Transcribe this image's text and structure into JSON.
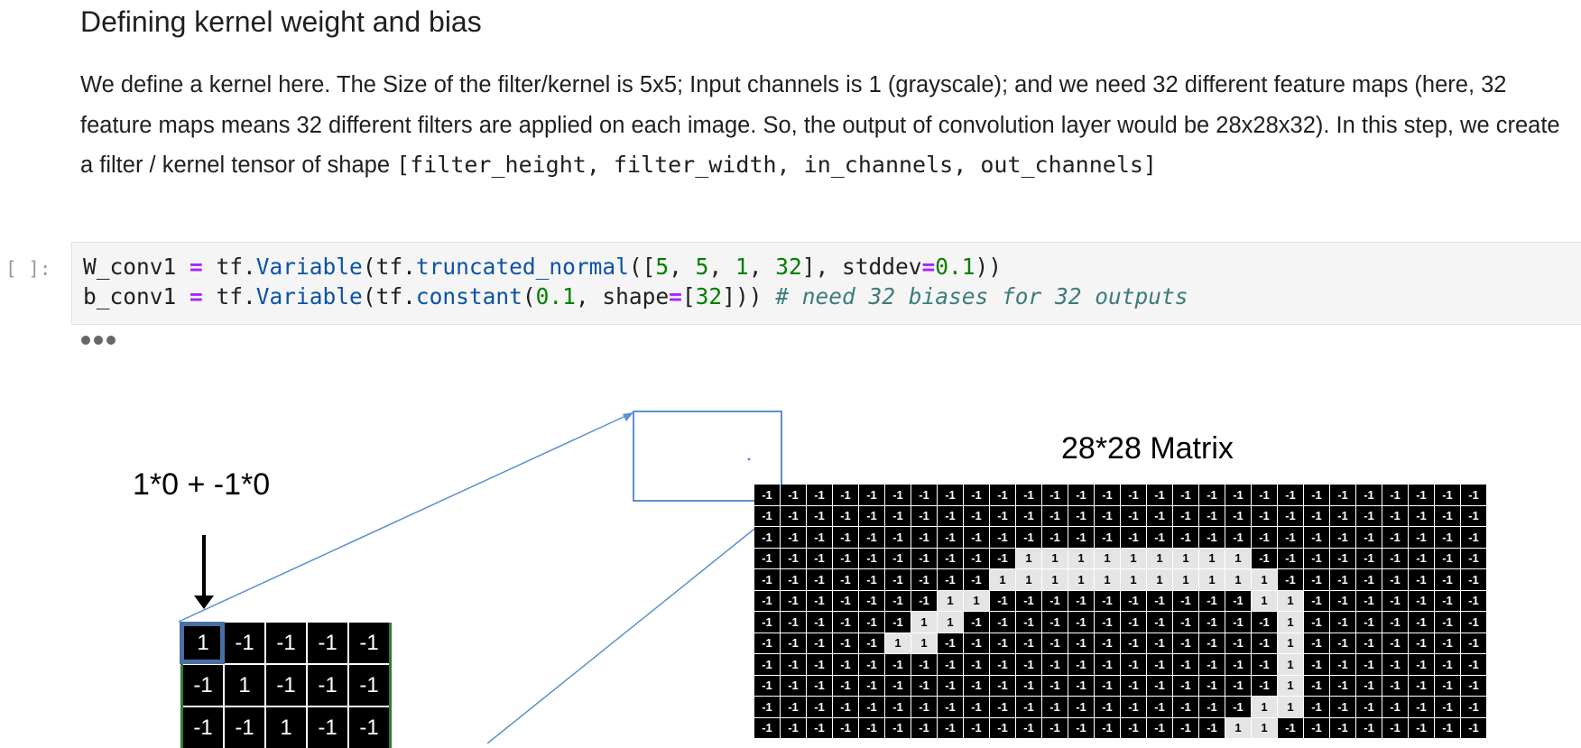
{
  "markdown": {
    "heading": "Defining kernel weight and bias",
    "paragraph_text": "We define a kernel here. The Size of the filter/kernel is 5x5; Input channels is 1 (grayscale); and we need 32 different feature maps (here, 32 feature maps means 32 different filters are applied on each image. So, the output of convolution layer would be 28x28x32). In this step, we create a filter / kernel tensor of shape ",
    "paragraph_code": "[filter_height, filter_width, in_channels, out_channels]"
  },
  "code_cell": {
    "prompt": "[ ]:",
    "lines": [
      "W_conv1 = tf.Variable(tf.truncated_normal([5, 5, 1, 32], stddev=0.1))",
      "b_conv1 = tf.Variable(tf.constant(0.1, shape=[32])) # need 32 biases for 32 outputs"
    ]
  },
  "figure": {
    "title": "28*28 Matrix",
    "formula": "1*0 + -1*0",
    "kernel_rows": [
      [
        "1",
        "-1",
        "-1",
        "-1",
        "-1"
      ],
      [
        "-1",
        "1",
        "-1",
        "-1",
        "-1"
      ],
      [
        "-1",
        "-1",
        "1",
        "-1",
        "-1"
      ]
    ],
    "matrix_cell_values": [
      "-1",
      "1"
    ],
    "matrix_ones": [
      [],
      [],
      [],
      [
        10,
        11,
        12,
        13,
        14,
        15,
        16,
        17,
        18
      ],
      [
        9,
        10,
        11,
        12,
        13,
        14,
        15,
        16,
        17,
        18,
        19
      ],
      [
        7,
        8,
        19,
        20
      ],
      [
        6,
        7,
        20
      ],
      [
        5,
        6,
        20
      ],
      [
        20
      ],
      [
        20
      ],
      [
        19,
        20
      ],
      [
        18,
        19
      ]
    ],
    "colors": {
      "arrow": "#5b8fd0",
      "kernel_border": "#2e7d32",
      "kernel_highlight": "#4a6fa5",
      "negative_cell": "#000000",
      "positive_cell": "#e5e5e5"
    }
  }
}
